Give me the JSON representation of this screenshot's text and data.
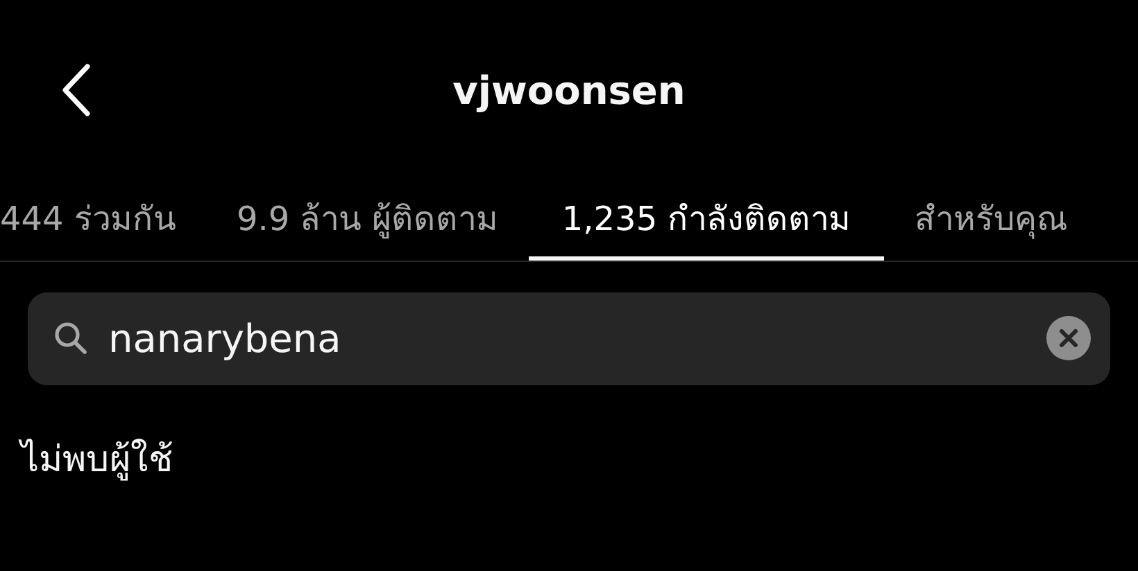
{
  "header": {
    "title": "vjwoonsen"
  },
  "tabs": [
    {
      "label": "444 ร่วมกัน",
      "selected": false
    },
    {
      "label": "9.9 ล้าน ผู้ติดตาม",
      "selected": false
    },
    {
      "label": "1,235 กำลังติดตาม",
      "selected": true
    },
    {
      "label": "สำหรับคุณ",
      "selected": false
    }
  ],
  "search": {
    "value": "nanarybena"
  },
  "message": "ไม่พบผู้ใช้"
}
